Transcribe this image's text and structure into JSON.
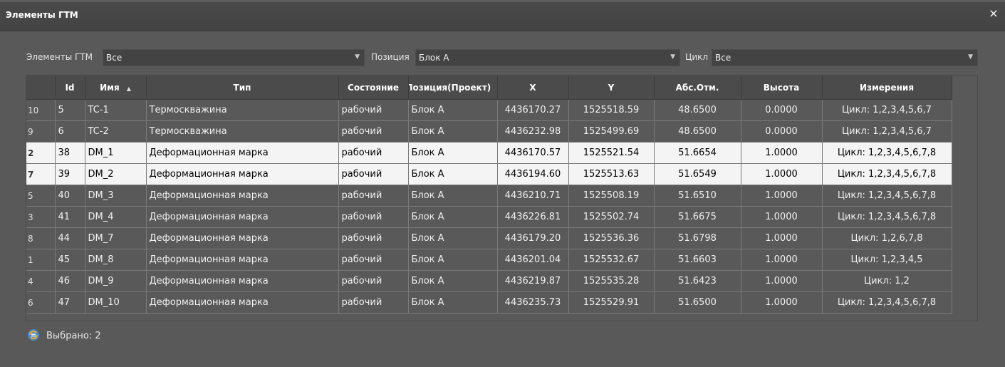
{
  "window": {
    "title": "Элементы ГТМ",
    "close": "×"
  },
  "filters": {
    "elements_label": "Элементы ГТМ",
    "elements_value": "Все",
    "position_label": "Позиция",
    "position_value": "Блок А",
    "cycle_label": "Цикл",
    "cycle_value": "Все"
  },
  "table": {
    "columns": [
      "Id",
      "Имя",
      "Тип",
      "Состояние",
      "Позиция(Проект)",
      "X",
      "Y",
      "Абс.Отм.",
      "Высота",
      "Измерения"
    ],
    "sort_indicator": "▲",
    "rows": [
      {
        "rownum": "10",
        "id": "5",
        "name": "TC-1",
        "type": "Термоскважина",
        "state": "рабочий",
        "position": "Блок А",
        "x": "4436170.27",
        "y": "1525518.59",
        "abs": "48.6500",
        "height": "0.0000",
        "measurements": "Цикл: 1,2,3,4,5,6,7",
        "selected": false
      },
      {
        "rownum": "9",
        "id": "6",
        "name": "TC-2",
        "type": "Термоскважина",
        "state": "рабочий",
        "position": "Блок А",
        "x": "4436232.98",
        "y": "1525499.69",
        "abs": "48.6500",
        "height": "0.0000",
        "measurements": "Цикл: 1,2,3,4,5,6,7",
        "selected": false
      },
      {
        "rownum": "2",
        "id": "38",
        "name": "DM_1",
        "type": "Деформационная марка",
        "state": "рабочий",
        "position": "Блок А",
        "x": "4436170.57",
        "y": "1525521.54",
        "abs": "51.6654",
        "height": "1.0000",
        "measurements": "Цикл: 1,2,3,4,5,6,7,8",
        "selected": true
      },
      {
        "rownum": "7",
        "id": "39",
        "name": "DM_2",
        "type": "Деформационная марка",
        "state": "рабочий",
        "position": "Блок А",
        "x": "4436194.60",
        "y": "1525513.63",
        "abs": "51.6549",
        "height": "1.0000",
        "measurements": "Цикл: 1,2,3,4,5,6,7,8",
        "selected": true
      },
      {
        "rownum": "5",
        "id": "40",
        "name": "DM_3",
        "type": "Деформационная марка",
        "state": "рабочий",
        "position": "Блок А",
        "x": "4436210.71",
        "y": "1525508.19",
        "abs": "51.6510",
        "height": "1.0000",
        "measurements": "Цикл: 1,2,3,4,5,6,7,8",
        "selected": false
      },
      {
        "rownum": "3",
        "id": "41",
        "name": "DM_4",
        "type": "Деформационная марка",
        "state": "рабочий",
        "position": "Блок А",
        "x": "4436226.81",
        "y": "1525502.74",
        "abs": "51.6675",
        "height": "1.0000",
        "measurements": "Цикл: 1,2,3,4,5,6,7,8",
        "selected": false
      },
      {
        "rownum": "8",
        "id": "44",
        "name": "DM_7",
        "type": "Деформационная марка",
        "state": "рабочий",
        "position": "Блок А",
        "x": "4436179.20",
        "y": "1525536.36",
        "abs": "51.6798",
        "height": "1.0000",
        "measurements": "Цикл: 1,2,6,7,8",
        "selected": false
      },
      {
        "rownum": "1",
        "id": "45",
        "name": "DM_8",
        "type": "Деформационная марка",
        "state": "рабочий",
        "position": "Блок А",
        "x": "4436201.04",
        "y": "1525532.67",
        "abs": "51.6603",
        "height": "1.0000",
        "measurements": "Цикл: 1,2,3,4,5",
        "selected": false
      },
      {
        "rownum": "4",
        "id": "46",
        "name": "DM_9",
        "type": "Деформационная марка",
        "state": "рабочий",
        "position": "Блок А",
        "x": "4436219.87",
        "y": "1525535.28",
        "abs": "51.6423",
        "height": "1.0000",
        "measurements": "Цикл: 1,2",
        "selected": false
      },
      {
        "rownum": "6",
        "id": "47",
        "name": "DM_10",
        "type": "Деформационная марка",
        "state": "рабочий",
        "position": "Блок А",
        "x": "4436235.73",
        "y": "1525529.91",
        "abs": "51.6500",
        "height": "1.0000",
        "measurements": "Цикл: 1,2,3,4,5,6,7,8",
        "selected": false
      }
    ]
  },
  "status": {
    "selected_text": "Выбрано: 2",
    "icon": "refresh-list-icon"
  }
}
